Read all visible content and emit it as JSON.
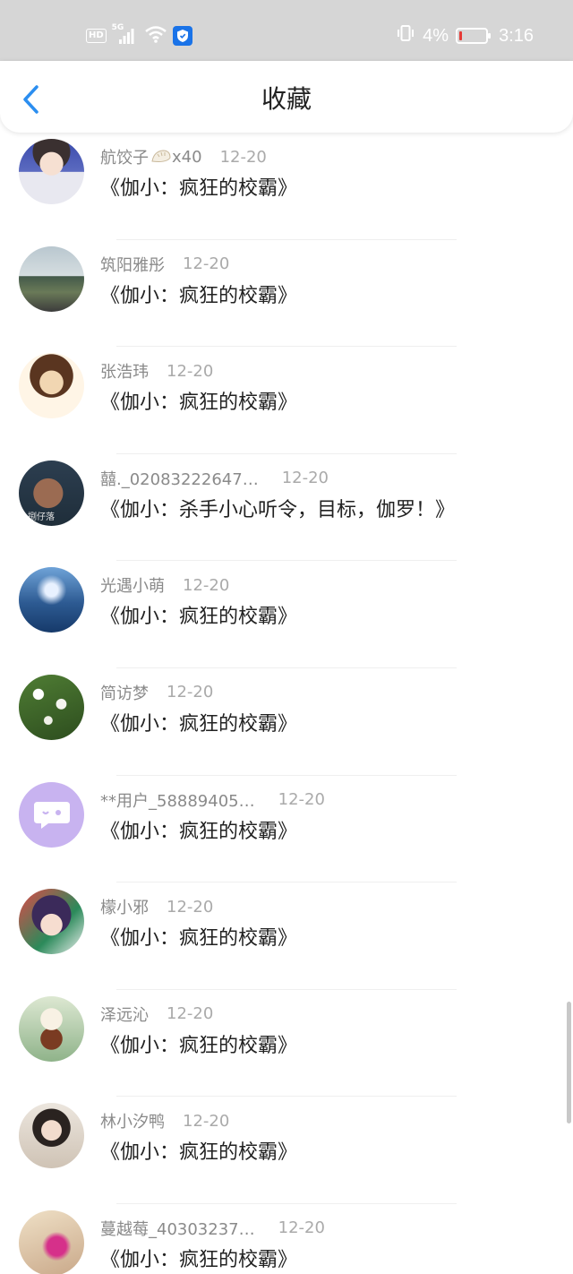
{
  "status_bar": {
    "hd_label": "HD",
    "network_label": "5G",
    "battery_text": "4%",
    "time": "3:16",
    "battery_level_percent": 4,
    "icons": [
      "signal-icon",
      "wifi-icon",
      "shield-app-icon",
      "vibrate-icon",
      "battery-icon"
    ]
  },
  "header": {
    "title": "收藏",
    "back_icon": "chevron-left-icon",
    "accent_color": "#2b8ef0"
  },
  "items": [
    {
      "name": "航饺子",
      "badge_icon": "dumpling-icon",
      "badge_count": "x40",
      "date": "12-20",
      "content": "《伽小：疯狂的校霸》"
    },
    {
      "name": "筑阳雅彤",
      "date": "12-20",
      "content": "《伽小：疯狂的校霸》"
    },
    {
      "name": "张浩玮",
      "date": "12-20",
      "content": "《伽小：疯狂的校霸》"
    },
    {
      "name": "囍._02083222647…",
      "avatar_text": "捌仔落",
      "date": "12-20",
      "content": "《伽小：杀手小心听令，目标，伽罗！》"
    },
    {
      "name": "光遇小萌",
      "date": "12-20",
      "content": "《伽小：疯狂的校霸》"
    },
    {
      "name": "简访梦",
      "date": "12-20",
      "content": "《伽小：疯狂的校霸》"
    },
    {
      "name": "**用户_58889405…",
      "date": "12-20",
      "content": "《伽小：疯狂的校霸》"
    },
    {
      "name": "檬小邪",
      "date": "12-20",
      "content": "《伽小：疯狂的校霸》"
    },
    {
      "name": "泽远沁",
      "date": "12-20",
      "content": "《伽小：疯狂的校霸》"
    },
    {
      "name": "林小汐鸭",
      "date": "12-20",
      "content": "《伽小：疯狂的校霸》"
    },
    {
      "name": "蔓越莓_40303237…",
      "date": "12-20",
      "content": "《伽小：疯狂的校霸》"
    }
  ]
}
